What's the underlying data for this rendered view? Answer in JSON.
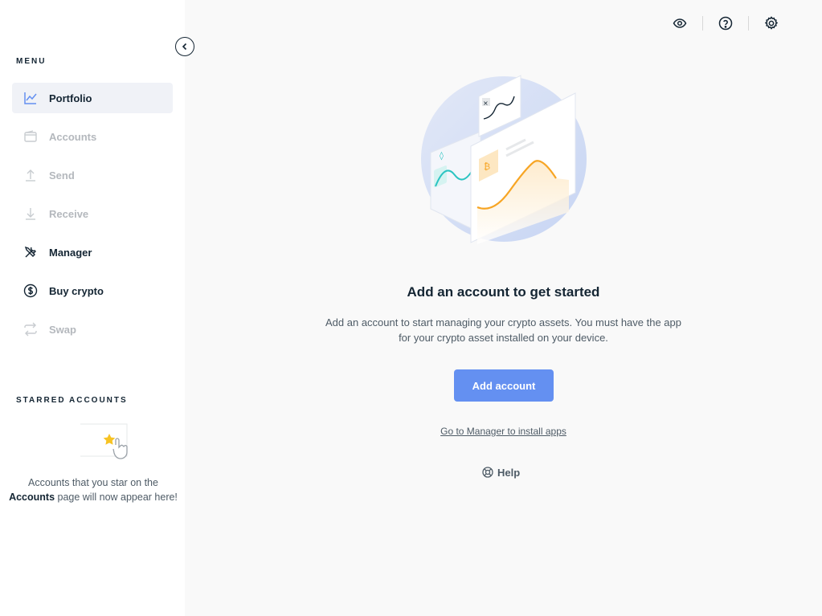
{
  "sidebar": {
    "menu_title": "MENU",
    "items": [
      {
        "label": "Portfolio",
        "icon": "chart-line-icon",
        "state": "active"
      },
      {
        "label": "Accounts",
        "icon": "wallet-icon",
        "state": "disabled"
      },
      {
        "label": "Send",
        "icon": "send-arrow-up-icon",
        "state": "disabled"
      },
      {
        "label": "Receive",
        "icon": "receive-arrow-down-icon",
        "state": "disabled"
      },
      {
        "label": "Manager",
        "icon": "tools-icon",
        "state": "enabled"
      },
      {
        "label": "Buy crypto",
        "icon": "dollar-circle-icon",
        "state": "enabled"
      },
      {
        "label": "Swap",
        "icon": "swap-arrows-icon",
        "state": "disabled"
      }
    ],
    "starred_title": "STARRED ACCOUNTS",
    "starred_text_before": "Accounts that you star on the ",
    "starred_text_bold": "Accounts",
    "starred_text_after": " page will now appear here!"
  },
  "topbar": {
    "icons": [
      "eye-icon",
      "help-circle-icon",
      "settings-gear-icon"
    ]
  },
  "empty_state": {
    "title": "Add an account to get started",
    "description": "Add an account to start managing your crypto assets. You must have the app for your crypto asset installed on your device.",
    "add_button": "Add account",
    "manager_link": "Go to Manager to install apps",
    "help_link": "Help"
  },
  "colors": {
    "accent": "#6490f1",
    "text_primary": "#142533",
    "text_secondary": "#4e5b66",
    "text_disabled": "#b4b8bd",
    "chart_orange": "#f7a524",
    "chart_teal": "#2bc4c2"
  }
}
